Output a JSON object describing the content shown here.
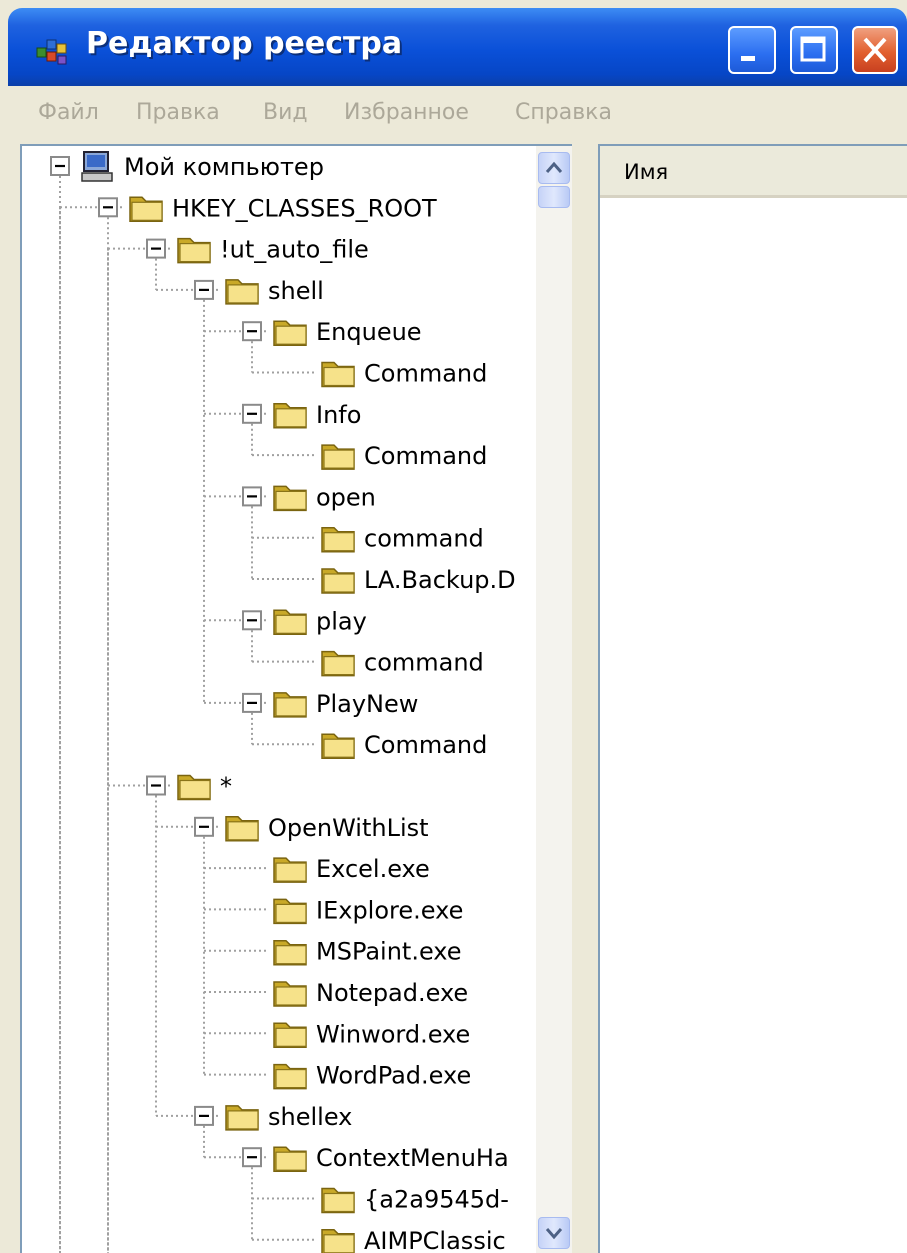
{
  "window": {
    "title": "Редактор реестра",
    "accent": "#0a50d8"
  },
  "menu": [
    "Файл",
    "Правка",
    "Вид",
    "Избранное",
    "Справка"
  ],
  "list": {
    "columns": [
      "Имя"
    ]
  },
  "tree": {
    "nodes": [
      {
        "label": "Мой компьютер",
        "level": 0,
        "icon": "computer-icon",
        "expanded": true
      },
      {
        "label": "HKEY_CLASSES_ROOT",
        "level": 1,
        "icon": "folder-icon",
        "expanded": true
      },
      {
        "label": "!ut_auto_file",
        "level": 2,
        "icon": "folder-icon",
        "expanded": true
      },
      {
        "label": "shell",
        "level": 3,
        "icon": "folder-icon",
        "expanded": true
      },
      {
        "label": "Enqueue",
        "level": 4,
        "icon": "folder-icon",
        "expanded": true
      },
      {
        "label": "Command",
        "level": 5,
        "icon": "folder-icon",
        "expanded": null
      },
      {
        "label": "Info",
        "level": 4,
        "icon": "folder-icon",
        "expanded": true
      },
      {
        "label": "Command",
        "level": 5,
        "icon": "folder-icon",
        "expanded": null
      },
      {
        "label": "open",
        "level": 4,
        "icon": "folder-icon",
        "expanded": true
      },
      {
        "label": "command",
        "level": 5,
        "icon": "folder-icon",
        "expanded": null
      },
      {
        "label": "LA.Backup.D",
        "level": 5,
        "icon": "folder-icon",
        "expanded": null
      },
      {
        "label": "play",
        "level": 4,
        "icon": "folder-icon",
        "expanded": true
      },
      {
        "label": "command",
        "level": 5,
        "icon": "folder-icon",
        "expanded": null
      },
      {
        "label": "PlayNew",
        "level": 4,
        "icon": "folder-icon",
        "expanded": true
      },
      {
        "label": "Command",
        "level": 5,
        "icon": "folder-icon",
        "expanded": null
      },
      {
        "label": "*",
        "level": 2,
        "icon": "folder-icon",
        "expanded": true
      },
      {
        "label": "OpenWithList",
        "level": 3,
        "icon": "folder-icon",
        "expanded": true
      },
      {
        "label": "Excel.exe",
        "level": 4,
        "icon": "folder-icon",
        "expanded": null
      },
      {
        "label": "IExplore.exe",
        "level": 4,
        "icon": "folder-icon",
        "expanded": null
      },
      {
        "label": "MSPaint.exe",
        "level": 4,
        "icon": "folder-icon",
        "expanded": null
      },
      {
        "label": "Notepad.exe",
        "level": 4,
        "icon": "folder-icon",
        "expanded": null
      },
      {
        "label": "Winword.exe",
        "level": 4,
        "icon": "folder-icon",
        "expanded": null
      },
      {
        "label": "WordPad.exe",
        "level": 4,
        "icon": "folder-icon",
        "expanded": null
      },
      {
        "label": "shellex",
        "level": 3,
        "icon": "folder-icon",
        "expanded": true
      },
      {
        "label": "ContextMenuHa",
        "level": 4,
        "icon": "folder-icon",
        "expanded": true
      },
      {
        "label": "{a2a9545d-",
        "level": 5,
        "icon": "folder-icon",
        "expanded": null
      },
      {
        "label": "AIMPClassic",
        "level": 5,
        "icon": "folder-icon",
        "expanded": null
      }
    ]
  }
}
